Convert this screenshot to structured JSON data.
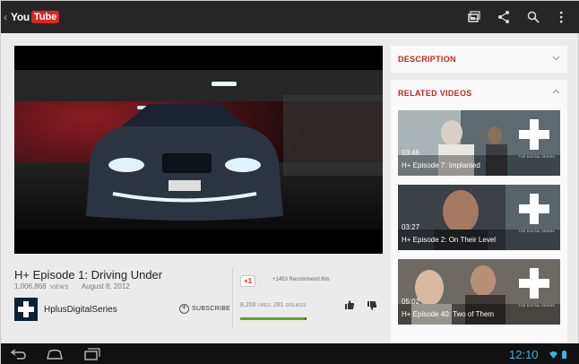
{
  "header": {
    "back_glyph": "‹",
    "logo_you": "You",
    "logo_tube": "Tube",
    "icons": [
      "cast-icon",
      "share-icon",
      "search-icon",
      "overflow-menu-icon"
    ]
  },
  "video": {
    "title": "H+ Episode 1: Driving Under",
    "views": "1,006,868",
    "views_label": "VIEWS",
    "date": "August 8, 2012",
    "channel": "HplusDigitalSeries",
    "subscribe_label": "SUBSCRIBE",
    "plus_one_label": "+1",
    "recommend_text": "+1453 Recommend this",
    "likes": "8,206",
    "likes_label": "LIKES,",
    "dislikes": "281",
    "dislikes_label": "DISLIKES",
    "like_ratio": 0.967
  },
  "sidebar": {
    "description_label": "DESCRIPTION",
    "related_label": "RELATED VIDEOS",
    "related": [
      {
        "duration": "03:46",
        "title": "H+ Episode 7: Implanted",
        "series": "THE DIGITAL SERIES"
      },
      {
        "duration": "03:27",
        "title": "H+ Episode 2: On Their Level",
        "series": "THE DIGITAL SERIES"
      },
      {
        "duration": "05:02",
        "title": "H+ Episode 40: Two of Them",
        "series": "THE DIGITAL SERIES"
      }
    ]
  },
  "status": {
    "time": "12:10"
  },
  "colors": {
    "accent_red": "#c9241c",
    "clock_blue": "#33b5e5",
    "like_green": "#5fa91e",
    "dislike_red": "#c1272d"
  }
}
